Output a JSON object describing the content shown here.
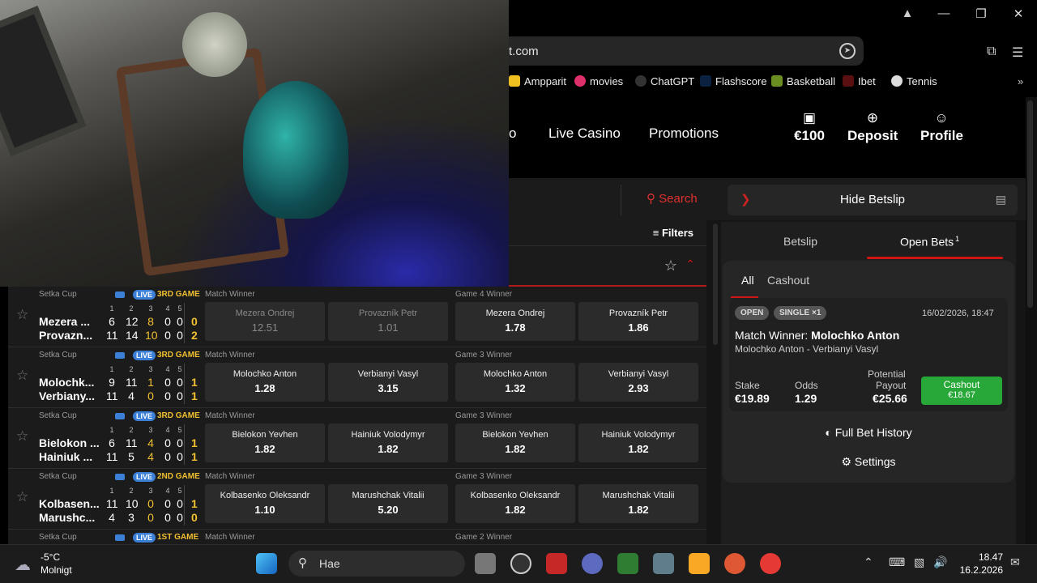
{
  "browser": {
    "address": "t.com",
    "bookmarks": [
      "Ampparit",
      "movies",
      "ChatGPT",
      "Flashscore",
      "Basketball",
      "Ibet",
      "Tennis"
    ]
  },
  "nav": {
    "partial": "o",
    "live_casino": "Live Casino",
    "promotions": "Promotions",
    "balance": "€100",
    "deposit": "Deposit",
    "profile": "Profile"
  },
  "search_label": "Search",
  "hide_betslip": "Hide Betslip",
  "filters": "Filters",
  "matches": [
    {
      "competition": "Setka Cup",
      "live": "LIVE",
      "game": "3RD GAME",
      "set_headers": [
        "1",
        "2",
        "3",
        "4",
        "5"
      ],
      "p1": {
        "name": "Mezera ...",
        "scores": [
          "6",
          "12",
          "8",
          "0",
          "0"
        ],
        "total": "0"
      },
      "p2": {
        "name": "Provazn...",
        "scores": [
          "11",
          "14",
          "10",
          "0",
          "0"
        ],
        "total": "2"
      },
      "market1": "Match Winner",
      "market2": "Game 4 Winner",
      "odds": [
        {
          "name": "Mezera Ondrej",
          "value": "12.51",
          "dim": true
        },
        {
          "name": "Provazník Petr",
          "value": "1.01",
          "dim": true
        },
        {
          "name": "Mezera Ondrej",
          "value": "1.78",
          "dim": false
        },
        {
          "name": "Provazník Petr",
          "value": "1.86",
          "dim": false
        }
      ]
    },
    {
      "competition": "Setka Cup",
      "live": "LIVE",
      "game": "3RD GAME",
      "set_headers": [
        "1",
        "2",
        "3",
        "4",
        "5"
      ],
      "p1": {
        "name": "Molochk...",
        "scores": [
          "9",
          "11",
          "1",
          "0",
          "0"
        ],
        "total": "1"
      },
      "p2": {
        "name": "Verbiany...",
        "scores": [
          "11",
          "4",
          "0",
          "0",
          "0"
        ],
        "total": "1"
      },
      "market1": "Match Winner",
      "market2": "Game 3 Winner",
      "odds": [
        {
          "name": "Molochko Anton",
          "value": "1.28",
          "dim": false
        },
        {
          "name": "Verbianyi Vasyl",
          "value": "3.15",
          "dim": false
        },
        {
          "name": "Molochko Anton",
          "value": "1.32",
          "dim": false
        },
        {
          "name": "Verbianyi Vasyl",
          "value": "2.93",
          "dim": false
        }
      ]
    },
    {
      "competition": "Setka Cup",
      "live": "LIVE",
      "game": "3RD GAME",
      "set_headers": [
        "1",
        "2",
        "3",
        "4",
        "5"
      ],
      "p1": {
        "name": "Bielokon ...",
        "scores": [
          "6",
          "11",
          "4",
          "0",
          "0"
        ],
        "total": "1"
      },
      "p2": {
        "name": "Hainiuk ...",
        "scores": [
          "11",
          "5",
          "4",
          "0",
          "0"
        ],
        "total": "1"
      },
      "market1": "Match Winner",
      "market2": "Game 3 Winner",
      "odds": [
        {
          "name": "Bielokon Yevhen",
          "value": "1.82",
          "dim": false
        },
        {
          "name": "Hainiuk Volodymyr",
          "value": "1.82",
          "dim": false
        },
        {
          "name": "Bielokon Yevhen",
          "value": "1.82",
          "dim": false
        },
        {
          "name": "Hainiuk Volodymyr",
          "value": "1.82",
          "dim": false
        }
      ]
    },
    {
      "competition": "Setka Cup",
      "live": "LIVE",
      "game": "2ND GAME",
      "set_headers": [
        "1",
        "2",
        "3",
        "4",
        "5"
      ],
      "p1": {
        "name": "Kolbasen...",
        "scores": [
          "11",
          "10",
          "0",
          "0",
          "0"
        ],
        "total": "1"
      },
      "p2": {
        "name": "Marushc...",
        "scores": [
          "4",
          "3",
          "0",
          "0",
          "0"
        ],
        "total": "0"
      },
      "market1": "Match Winner",
      "market2": "Game 3 Winner",
      "odds": [
        {
          "name": "Kolbasenko Oleksandr",
          "value": "1.10",
          "dim": false
        },
        {
          "name": "Marushchak Vitalii",
          "value": "5.20",
          "dim": false
        },
        {
          "name": "Kolbasenko Oleksandr",
          "value": "1.82",
          "dim": false
        },
        {
          "name": "Marushchak Vitalii",
          "value": "1.82",
          "dim": false
        }
      ]
    },
    {
      "competition": "Setka Cup",
      "live": "LIVE",
      "game": "1ST GAME",
      "market1": "Match Winner",
      "market2": "Game 2 Winner"
    }
  ],
  "betslip": {
    "tab_betslip": "Betslip",
    "tab_open": "Open Bets",
    "open_count": "1",
    "sub_all": "All",
    "sub_cashout": "Cashout",
    "badge_open": "OPEN",
    "badge_single": "SINGLE ×1",
    "date": "16/02/2026, 18:47",
    "market": "Match Winner:",
    "selection": "Molochko Anton",
    "event": "Molochko Anton - Verbianyi Vasyl",
    "stake_label": "Stake",
    "stake": "€19.89",
    "odds_label": "Odds",
    "odds": "1.29",
    "payout_label1": "Potential",
    "payout_label2": "Payout",
    "payout": "€25.66",
    "cashout_label": "Cashout",
    "cashout_value": "€18.67",
    "history": "Full Bet History",
    "settings": "Settings"
  },
  "taskbar": {
    "temp": "-5°C",
    "weather": "Molnigt",
    "search": "Hae",
    "time": "18.47",
    "date": "16.2.2026"
  }
}
